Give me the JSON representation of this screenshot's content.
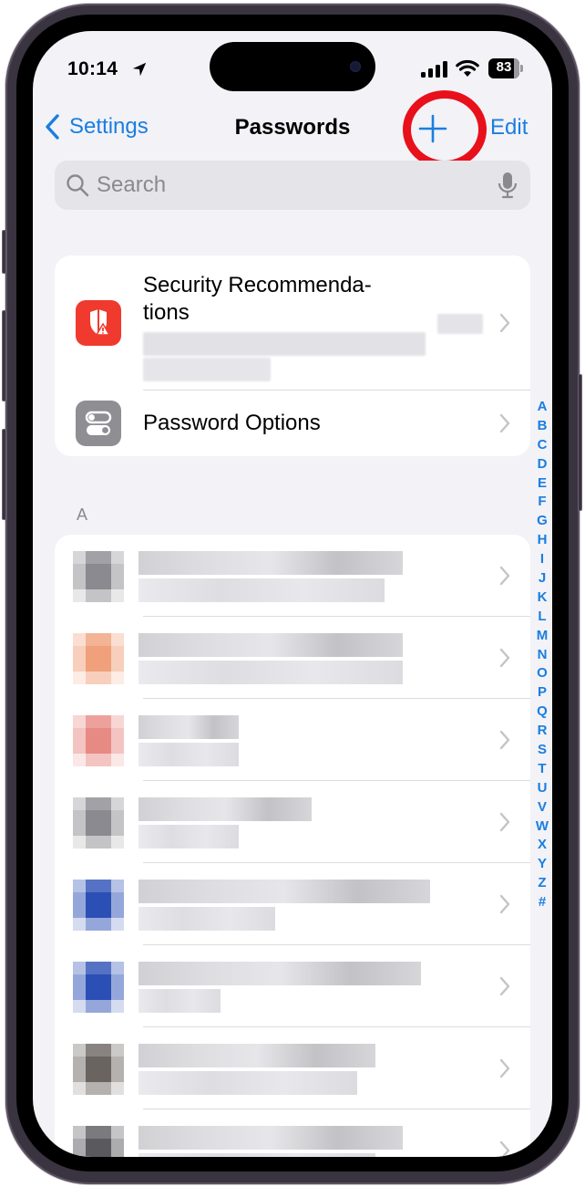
{
  "status_bar": {
    "time": "10:14",
    "location_icon": "location-arrow-icon",
    "signal_icon": "cellular-signal-icon",
    "wifi_icon": "wifi-icon",
    "battery_percent": "83",
    "battery_level": 0.83
  },
  "nav": {
    "back_label": "Settings",
    "title": "Passwords",
    "add_icon": "plus-icon",
    "edit_label": "Edit"
  },
  "search": {
    "placeholder": "Search",
    "value": "",
    "icon": "magnifying-glass-icon",
    "mic_icon": "microphone-icon"
  },
  "top_section": {
    "items": [
      {
        "label": "Security Recommenda-\ntions",
        "icon": "shield-warning-icon",
        "icon_color": "#f03a2e",
        "detail": "[blurred]"
      },
      {
        "label": "Password Options",
        "icon": "toggle-options-icon",
        "icon_color": "#8e8e93"
      }
    ]
  },
  "list": {
    "section_header": "A",
    "entries": [
      {
        "title": "[blurred]",
        "subtitle": "[blurred]",
        "icon_tint": "#8a8a90"
      },
      {
        "title": "[blurred]",
        "subtitle": "[blurred]",
        "icon_tint": "#f0a07a"
      },
      {
        "title": "[blurred]",
        "subtitle": "[blurred]",
        "icon_tint": "#e88a84"
      },
      {
        "title": "[blurred]",
        "subtitle": "[blurred]",
        "icon_tint": "#8a8a90"
      },
      {
        "title": "[blurred]",
        "subtitle": "[blurred]",
        "icon_tint": "#2c4fb5"
      },
      {
        "title": "[blurred]",
        "subtitle": "[blurred]",
        "icon_tint": "#2c4fb5"
      },
      {
        "title": "[blurred]",
        "subtitle": "[blurred]",
        "icon_tint": "#6a6460"
      },
      {
        "title": "[blurred]",
        "subtitle": "[blurred]",
        "icon_tint": "#5a5a5e"
      }
    ]
  },
  "index_bar": {
    "letters": [
      "A",
      "B",
      "C",
      "D",
      "E",
      "F",
      "G",
      "H",
      "I",
      "J",
      "K",
      "L",
      "M",
      "N",
      "O",
      "P",
      "Q",
      "R",
      "S",
      "T",
      "U",
      "V",
      "W",
      "X",
      "Y",
      "Z",
      "#"
    ]
  },
  "annotation": {
    "type": "red-circle-highlight",
    "target": "add-button",
    "color": "#e8101a"
  },
  "colors": {
    "accent": "#1a7ee0",
    "background": "#f2f2f7",
    "card": "#ffffff"
  }
}
